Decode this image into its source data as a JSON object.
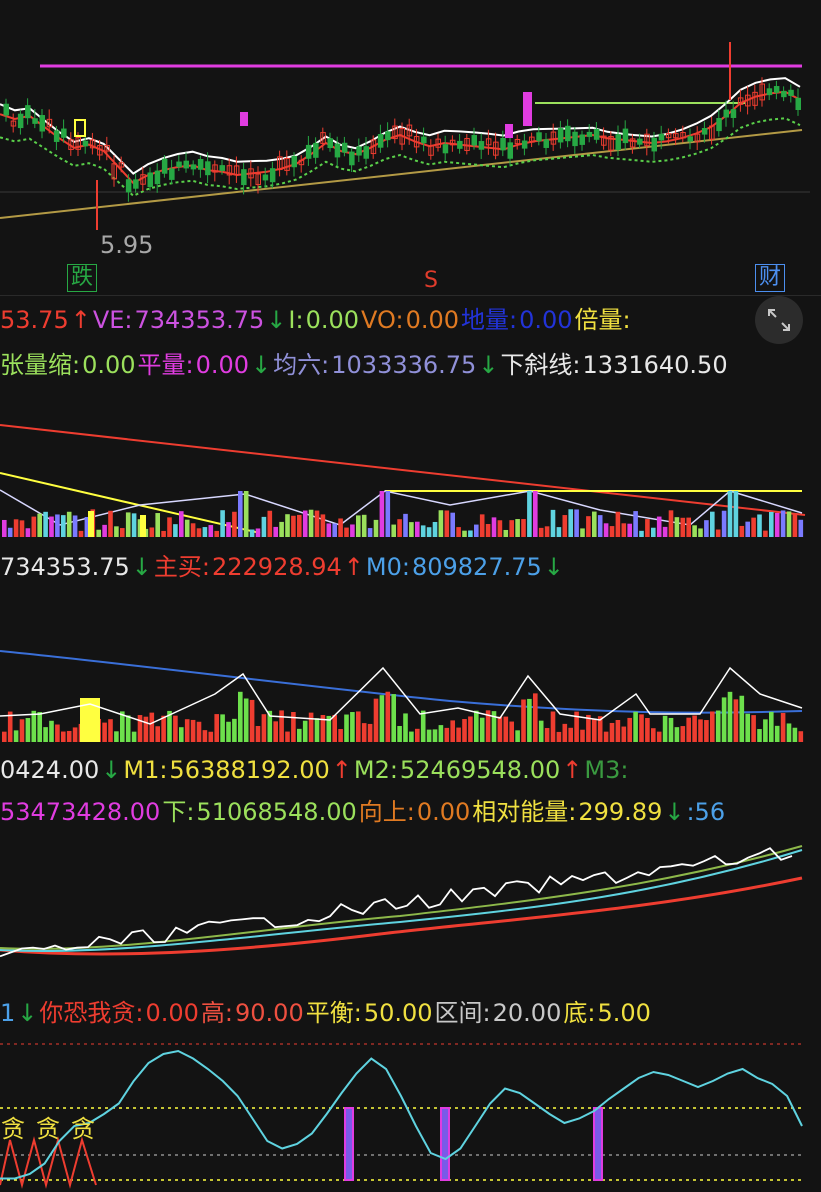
{
  "colors": {
    "up": "#ee3d30",
    "down": "#27a844",
    "magenta": "#e03ce0",
    "white": "#ffffff",
    "yellow": "#ffff40",
    "cyan": "#5fd3e0",
    "gold": "#b39a45",
    "green": "#9be05c",
    "blue": "#3a6fd8"
  },
  "main_chart": {
    "low_label": "5.95",
    "tags": [
      {
        "text": "跌",
        "color": "#27a844"
      },
      {
        "text": "S",
        "color": "#e03c2c"
      },
      {
        "text": "财",
        "color": "#4c8ff0"
      }
    ]
  },
  "vol_line1": [
    {
      "text": "53.75",
      "color": "#ee3d30"
    },
    {
      "text": "↑",
      "color": "#ee3d30"
    },
    {
      "text": "VE:",
      "color": "#cc52e0"
    },
    {
      "text": "734353.75",
      "color": "#cc52e0"
    },
    {
      "text": "↓",
      "color": "#27a844"
    },
    {
      "text": "I:",
      "color": "#9be05c"
    },
    {
      "text": "0.00",
      "color": "#9be05c"
    },
    {
      "text": "VO:",
      "color": "#e07a22"
    },
    {
      "text": "0.00",
      "color": "#e07a22"
    },
    {
      "text": "地量:",
      "color": "#2233d8"
    },
    {
      "text": "0.00",
      "color": "#2233d8"
    },
    {
      "text": "倍量:",
      "color": "#f0e040"
    }
  ],
  "vol_line2": [
    {
      "text": "张量缩:",
      "color": "#9be05c"
    },
    {
      "text": "0.00",
      "color": "#9be05c"
    },
    {
      "text": "平量:",
      "color": "#e03ce0"
    },
    {
      "text": "0.00",
      "color": "#e03ce0"
    },
    {
      "text": "↓",
      "color": "#27a844"
    },
    {
      "text": "均六:",
      "color": "#9090d8"
    },
    {
      "text": "1033336.75",
      "color": "#9090d8"
    },
    {
      "text": "↓",
      "color": "#27a844"
    },
    {
      "text": "下斜线:",
      "color": "#e8e8e8"
    },
    {
      "text": "1331640.50",
      "color": "#e8e8e8"
    }
  ],
  "vol2_line": [
    {
      "text": "734353.75",
      "color": "#e8e8e8"
    },
    {
      "text": "↓",
      "color": "#27a844"
    },
    {
      "text": "主买:",
      "color": "#ee3d30"
    },
    {
      "text": "222928.94",
      "color": "#ee3d30"
    },
    {
      "text": "↑",
      "color": "#ee3d30"
    },
    {
      "text": "M0:",
      "color": "#4ca0e8"
    },
    {
      "text": "809827.75",
      "color": "#4ca0e8"
    },
    {
      "text": "↓",
      "color": "#27a844"
    }
  ],
  "energy_line1": [
    {
      "text": "0424.00",
      "color": "#e8e8e8"
    },
    {
      "text": "↓",
      "color": "#27a844"
    },
    {
      "text": "M1:",
      "color": "#f0e040"
    },
    {
      "text": "56388192.00",
      "color": "#f0e040"
    },
    {
      "text": "↑",
      "color": "#ee3d30"
    },
    {
      "text": "M2:",
      "color": "#9be05c"
    },
    {
      "text": "52469548.00",
      "color": "#9be05c"
    },
    {
      "text": "↑",
      "color": "#ee3d30"
    },
    {
      "text": "M3:",
      "color": "#3a9a40"
    }
  ],
  "energy_line2": [
    {
      "text": "53473428.00",
      "color": "#e03ce0"
    },
    {
      "text": "下:",
      "color": "#9be05c"
    },
    {
      "text": "51068548.00",
      "color": "#9be05c"
    },
    {
      "text": "向上:",
      "color": "#e07a22"
    },
    {
      "text": "0.00",
      "color": "#e07a22"
    },
    {
      "text": "相对能量:",
      "color": "#f0e040"
    },
    {
      "text": "299.89",
      "color": "#f0e040"
    },
    {
      "text": "↓",
      "color": "#27a844"
    },
    {
      "text": ":56",
      "color": "#4ca0e8"
    }
  ],
  "osc_line": [
    {
      "text": "1",
      "color": "#4ca0e8"
    },
    {
      "text": "↓",
      "color": "#27a844"
    },
    {
      "text": "你恐我贪:",
      "color": "#ee3d30"
    },
    {
      "text": "0.00",
      "color": "#ee3d30"
    },
    {
      "text": "高:",
      "color": "#ee5040"
    },
    {
      "text": "90.00",
      "color": "#ee5040"
    },
    {
      "text": "平衡:",
      "color": "#f0e040"
    },
    {
      "text": "50.00",
      "color": "#f0e040"
    },
    {
      "text": "区间:",
      "color": "#c8c8c8"
    },
    {
      "text": "20.00",
      "color": "#c8c8c8"
    },
    {
      "text": "底:",
      "color": "#f0e040"
    },
    {
      "text": "5.00",
      "color": "#f0e040"
    }
  ],
  "osc_chart": {
    "greed_labels": [
      "贪",
      "贪",
      "贪"
    ]
  },
  "chart_data": [
    {
      "type": "line",
      "name": "price-panel",
      "low_label": "5.95",
      "trend_lines": [
        "resistance",
        "support"
      ],
      "series": [
        {
          "name": "MA-short",
          "color": "#ee3d30",
          "values": [
            63,
            60,
            62,
            55,
            48,
            42,
            44,
            40,
            30,
            20,
            25,
            28,
            30,
            31,
            28,
            27,
            25,
            26,
            27,
            29,
            32,
            38,
            45,
            40,
            38,
            42,
            47,
            50,
            46,
            43,
            45,
            44,
            43,
            42,
            41,
            44,
            46,
            47,
            48,
            49,
            50,
            48,
            47,
            46,
            45,
            46,
            48,
            51,
            55,
            62,
            70,
            74,
            76,
            77,
            72
          ]
        },
        {
          "name": "MA-long",
          "color": "#b39a45",
          "values": [
            10,
            11,
            12,
            13,
            14,
            15,
            16,
            17,
            18,
            19,
            20,
            21,
            22,
            23,
            24,
            25,
            26,
            27,
            28,
            29,
            30,
            31,
            32,
            33,
            34,
            35,
            36,
            37,
            38,
            39,
            40,
            41,
            42,
            43,
            44,
            45,
            46,
            47,
            48,
            49,
            50,
            51,
            52,
            53,
            54,
            55,
            56,
            57,
            58,
            59,
            60,
            61,
            62,
            63,
            64
          ]
        }
      ]
    },
    {
      "type": "bar",
      "name": "volume-panel-1"
    },
    {
      "type": "bar",
      "name": "volume-panel-2"
    },
    {
      "type": "line",
      "name": "energy-panel",
      "series": [
        {
          "name": "M1"
        },
        {
          "name": "M2"
        },
        {
          "name": "M3"
        }
      ]
    },
    {
      "type": "line",
      "name": "fear-greed-panel",
      "levels": {
        "高": 90,
        "平衡": 50,
        "区间": 20,
        "底": 5
      },
      "series": [
        {
          "name": "oscillator",
          "color": "#5fd3e0",
          "values": [
            5,
            5,
            8,
            15,
            30,
            40,
            42,
            48,
            55,
            70,
            82,
            88,
            90,
            85,
            78,
            70,
            60,
            45,
            30,
            25,
            28,
            35,
            48,
            62,
            75,
            85,
            78,
            60,
            40,
            22,
            18,
            25,
            40,
            55,
            65,
            62,
            55,
            48,
            42,
            45,
            50,
            58,
            65,
            72,
            76,
            74,
            70,
            66,
            70,
            75,
            78,
            72,
            68,
            60,
            40
          ]
        }
      ]
    }
  ]
}
